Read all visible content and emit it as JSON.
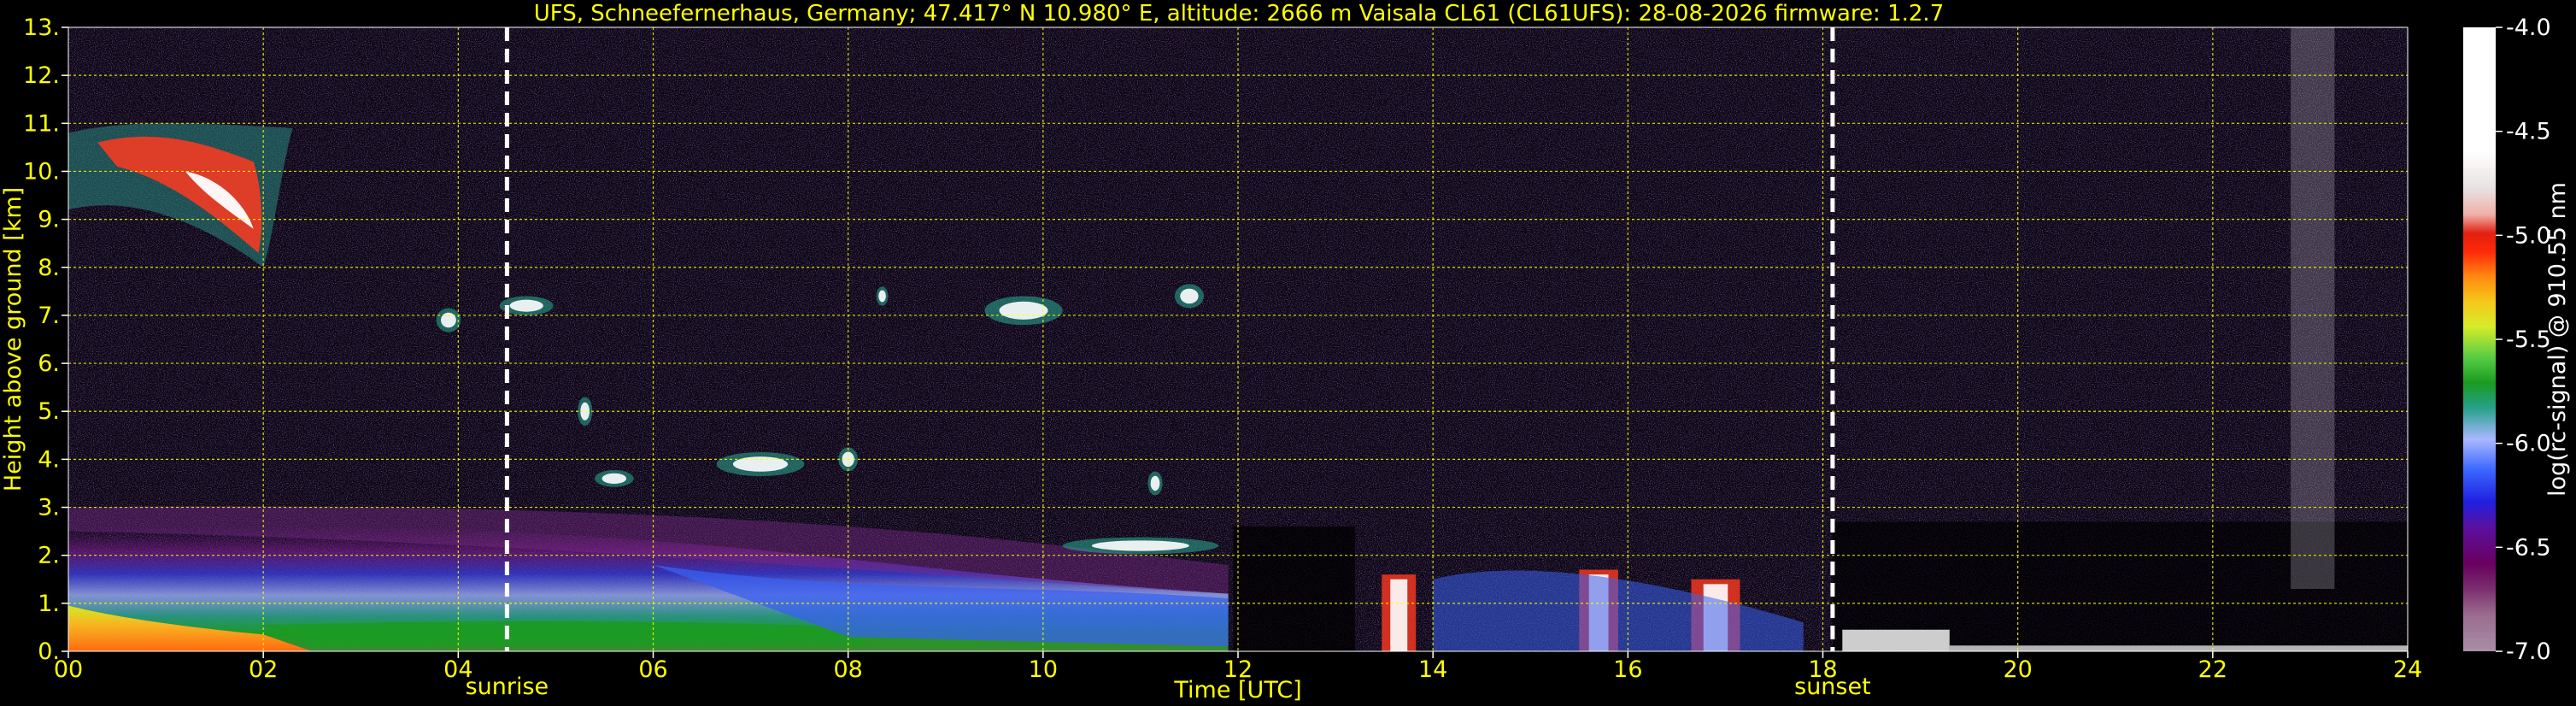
{
  "chart_data": {
    "type": "heatmap",
    "title": "UFS, Schneefernerhaus, Germany; 47.417° N 10.980° E, altitude: 2666 m    Vaisala CL61 (CL61UFS): 28-08-2026    firmware: 1.2.7",
    "xlabel": "Time [UTC]",
    "ylabel": "Height above ground [km]",
    "xlim": [
      0,
      24
    ],
    "ylim": [
      0,
      13
    ],
    "x_ticks": [
      "00",
      "02",
      "04",
      "06",
      "08",
      "10",
      "12",
      "14",
      "16",
      "18",
      "20",
      "22",
      "24"
    ],
    "y_ticks": [
      "0.",
      "1.",
      "2.",
      "3.",
      "4.",
      "5.",
      "6.",
      "7.",
      "8.",
      "9.",
      "10.",
      "11.",
      "12.",
      "13."
    ],
    "grid": true,
    "grid_color": "#ffff00",
    "events": [
      {
        "label": "sunrise",
        "time_h": 4.5
      },
      {
        "label": "sunset",
        "time_h": 18.1
      }
    ],
    "colorbar": {
      "label": "log(rc-signal) @ 910.55 nm",
      "min": -7.0,
      "max": -4.0,
      "ticks": [
        "-4.0",
        "-4.5",
        "-5.0",
        "-5.5",
        "-6.0",
        "-6.5",
        "-7.0"
      ]
    }
  }
}
